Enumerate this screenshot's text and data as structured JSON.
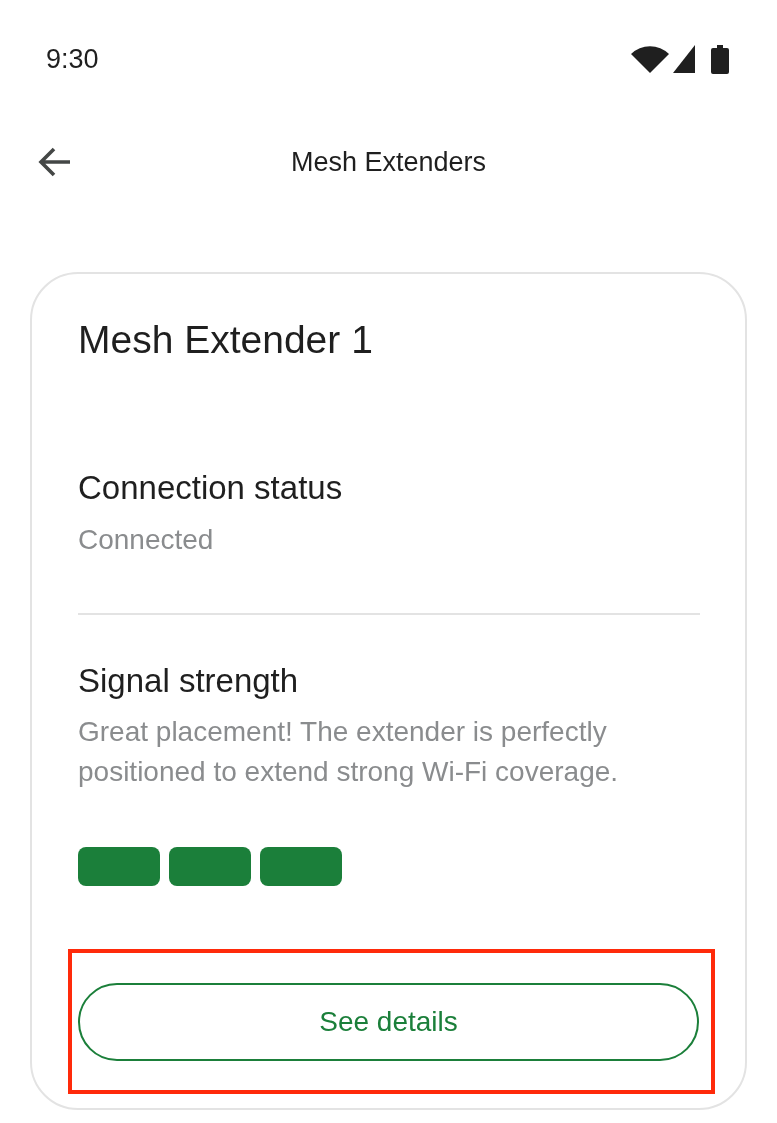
{
  "status_bar": {
    "time": "9:30"
  },
  "app_bar": {
    "title": "Mesh Extenders"
  },
  "card": {
    "title": "Mesh Extender 1",
    "sections": [
      {
        "kind": "status",
        "label": "Connection status",
        "value": "Connected"
      },
      {
        "kind": "signal",
        "label": "Signal strength",
        "description": "Great placement! The extender is perfectly positioned to extend strong Wi-Fi coverage.",
        "bars": [
          {
            "on": true
          },
          {
            "on": true
          },
          {
            "on": true
          }
        ]
      }
    ],
    "button": {
      "label": "See details",
      "highlighted": true
    }
  }
}
